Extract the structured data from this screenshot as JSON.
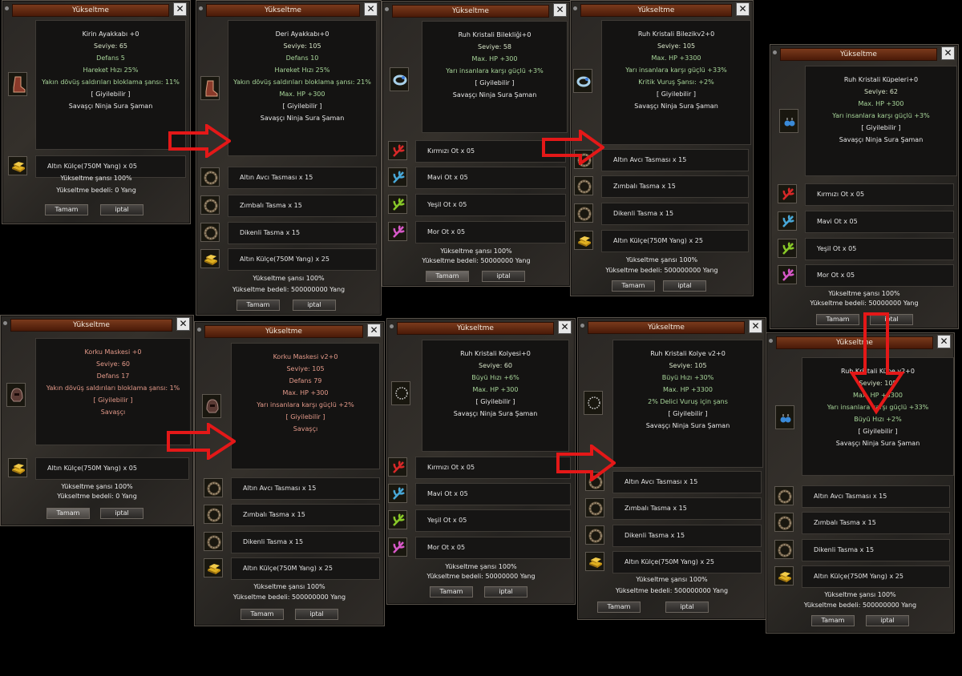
{
  "window_title": "Yükseltme",
  "close_label": "✕",
  "ok_label": "Tamam",
  "cancel_label": "iptal",
  "chance_label": "Yükseltme şansı 100%",
  "cost_0": "Yükseltme bedeli: 0 Yang",
  "cost_500m": "Yükseltme bedeli: 500000000 Yang",
  "cost_50m": "Yükseltme bedeli: 50000000 Yang",
  "wearable": "[ Giyilebilir ]",
  "all_classes": "Savaşçı Ninja Sura Şaman",
  "warrior_only": "Savaşçı",
  "colors": {
    "title_bar": "#6a2e14",
    "stat_green": "#a8d69a",
    "class_red": "#e49a8a",
    "arrow": "#e41818"
  },
  "panels": [
    {
      "name": "kirin-boots",
      "icon": "boots-icon",
      "lines": [
        [
          "Kirin Ayakkabı +0",
          "c-white"
        ],
        [
          "Seviye: 65",
          "c-pale"
        ],
        [
          "Defans 5",
          "c-green"
        ],
        [
          "Hareket Hızı 25%",
          "c-green"
        ],
        [
          "Yakın dövüş saldırıları bloklama şansı: 11%",
          "c-green"
        ],
        [
          "[ Giyilebilir ]",
          "c-white"
        ],
        [
          "Savaşçı Ninja Sura Şaman",
          "c-white"
        ]
      ],
      "materials": [
        {
          "label": "Altın Külçe(750M Yang) x 05",
          "icon": "gold-bar-icon"
        }
      ],
      "cost": "Yükseltme bedeli: 0 Yang"
    },
    {
      "name": "leather-boots",
      "icon": "boots-icon",
      "lines": [
        [
          "Deri Ayakkabı+0",
          "c-white"
        ],
        [
          "Seviye: 105",
          "c-pale"
        ],
        [
          "Defans 10",
          "c-green"
        ],
        [
          "Hareket Hızı 25%",
          "c-green"
        ],
        [
          "Yakın dövüş saldırıları bloklama şansı: 21%",
          "c-green"
        ],
        [
          "Max. HP +300",
          "c-green"
        ],
        [
          "[ Giyilebilir ]",
          "c-white"
        ],
        [
          "Savaşçı Ninja Sura Şaman",
          "c-white"
        ]
      ],
      "materials": [
        {
          "label": "Altın Avcı Tasması x 15",
          "icon": "collar-icon"
        },
        {
          "label": "Zımbalı Tasma x 15",
          "icon": "collar-icon"
        },
        {
          "label": "Dikenli Tasma x 15",
          "icon": "collar-icon"
        },
        {
          "label": "Altın Külçe(750M Yang) x 25",
          "icon": "gold-bar-icon"
        }
      ],
      "cost": "Yükseltme bedeli: 500000000 Yang"
    },
    {
      "name": "soul-crystal-bracelet",
      "icon": "bracelet-icon",
      "lines": [
        [
          "Ruh Kristali Bilekliği+0",
          "c-white"
        ],
        [
          "Seviye: 58",
          "c-pale"
        ],
        [
          "Max. HP +300",
          "c-green"
        ],
        [
          "Yarı insanlara karşı güçlü +3%",
          "c-green"
        ],
        [
          "[ Giyilebilir ]",
          "c-white"
        ],
        [
          "Savaşçı Ninja Sura Şaman",
          "c-white"
        ]
      ],
      "materials": [
        {
          "label": "Kırmızı Ot x 05",
          "icon": "red-herb-icon"
        },
        {
          "label": "Mavi Ot x 05",
          "icon": "blue-herb-icon"
        },
        {
          "label": "Yeşil Ot x 05",
          "icon": "green-herb-icon"
        },
        {
          "label": "Mor Ot x 05",
          "icon": "purple-herb-icon"
        }
      ],
      "cost": "Yükseltme bedeli: 50000000 Yang"
    },
    {
      "name": "soul-crystal-bracelet-v2",
      "icon": "bracelet-icon",
      "lines": [
        [
          "Ruh Kristali Bilezikv2+0",
          "c-white"
        ],
        [
          "Seviye: 105",
          "c-pale"
        ],
        [
          "Max. HP +3300",
          "c-green"
        ],
        [
          "Yarı insanlara karşı güçlü +33%",
          "c-green"
        ],
        [
          "Kritik Vuruş Şansı: +2%",
          "c-green"
        ],
        [
          "[ Giyilebilir ]",
          "c-white"
        ],
        [
          "Savaşçı Ninja Sura Şaman",
          "c-white"
        ]
      ],
      "materials": [
        {
          "label": "Altın Avcı Tasması x 15",
          "icon": "collar-icon"
        },
        {
          "label": "Zımbalı Tasma x 15",
          "icon": "collar-icon"
        },
        {
          "label": "Dikenli Tasma x 15",
          "icon": "collar-icon"
        },
        {
          "label": "Altın Külçe(750M Yang) x 25",
          "icon": "gold-bar-icon"
        }
      ],
      "cost": "Yükseltme bedeli: 500000000 Yang"
    },
    {
      "name": "soul-crystal-earrings",
      "icon": "earring-icon",
      "lines": [
        [
          "Ruh Kristali Küpeleri+0",
          "c-white"
        ],
        [
          "Seviye: 62",
          "c-pale"
        ],
        [
          "Max. HP +300",
          "c-green"
        ],
        [
          "Yarı insanlara karşı güçlü +3%",
          "c-green"
        ],
        [
          "[ Giyilebilir ]",
          "c-white"
        ],
        [
          "Savaşçı Ninja Sura Şaman",
          "c-white"
        ]
      ],
      "materials": [
        {
          "label": "Kırmızı Ot x 05",
          "icon": "red-herb-icon"
        },
        {
          "label": "Mavi Ot x 05",
          "icon": "blue-herb-icon"
        },
        {
          "label": "Yeşil Ot x 05",
          "icon": "green-herb-icon"
        },
        {
          "label": "Mor Ot x 05",
          "icon": "purple-herb-icon"
        }
      ],
      "cost": "Yükseltme bedeli: 50000000 Yang"
    },
    {
      "name": "fear-mask",
      "icon": "helmet-icon",
      "lines": [
        [
          "Korku Maskesi +0",
          "c-red"
        ],
        [
          "Seviye: 60",
          "c-red"
        ],
        [
          "Defans 17",
          "c-red"
        ],
        [
          "Yakın dövüş saldırıları bloklama şansı: 1%",
          "c-red"
        ],
        [
          "[ Giyilebilir ]",
          "c-red"
        ],
        [
          "Savaşçı",
          "c-red"
        ]
      ],
      "materials": [
        {
          "label": "Altın Külçe(750M Yang) x 05",
          "icon": "gold-bar-icon"
        }
      ],
      "cost": "Yükseltme bedeli: 0 Yang"
    },
    {
      "name": "fear-mask-v2",
      "icon": "helmet-icon",
      "lines": [
        [
          "Korku Maskesi v2+0",
          "c-red"
        ],
        [
          "Seviye: 105",
          "c-red"
        ],
        [
          "Defans 79",
          "c-red"
        ],
        [
          "Max. HP +300",
          "c-red"
        ],
        [
          "Yarı insanlara karşı güçlü +2%",
          "c-red"
        ],
        [
          "[ Giyilebilir ]",
          "c-red"
        ],
        [
          "Savaşçı",
          "c-red"
        ]
      ],
      "materials": [
        {
          "label": "Altın Avcı Tasması x 15",
          "icon": "collar-icon"
        },
        {
          "label": "Zımbalı Tasma x 15",
          "icon": "collar-icon"
        },
        {
          "label": "Dikenli Tasma x 15",
          "icon": "collar-icon"
        },
        {
          "label": "Altın Külçe(750M Yang) x 25",
          "icon": "gold-bar-icon"
        }
      ],
      "cost": "Yükseltme bedeli: 500000000 Yang"
    },
    {
      "name": "soul-crystal-necklace",
      "icon": "necklace-icon",
      "lines": [
        [
          "Ruh Kristali Kolyesi+0",
          "c-white"
        ],
        [
          "Seviye: 60",
          "c-pale"
        ],
        [
          "Büyü Hızı +6%",
          "c-green"
        ],
        [
          "Max. HP +300",
          "c-green"
        ],
        [
          "[ Giyilebilir ]",
          "c-white"
        ],
        [
          "Savaşçı Ninja Sura Şaman",
          "c-white"
        ]
      ],
      "materials": [
        {
          "label": "Kırmızı Ot x 05",
          "icon": "red-herb-icon"
        },
        {
          "label": "Mavi Ot x 05",
          "icon": "blue-herb-icon"
        },
        {
          "label": "Yeşil Ot x 05",
          "icon": "green-herb-icon"
        },
        {
          "label": "Mor Ot x 05",
          "icon": "purple-herb-icon"
        }
      ],
      "cost": "Yükseltme bedeli: 50000000 Yang"
    },
    {
      "name": "soul-crystal-necklace-v2",
      "icon": "necklace-icon",
      "lines": [
        [
          "Ruh Kristali Kolye v2+0",
          "c-white"
        ],
        [
          "Seviye: 105",
          "c-pale"
        ],
        [
          "Büyü Hızı +30%",
          "c-green"
        ],
        [
          "Max. HP +3300",
          "c-green"
        ],
        [
          "2% Delici Vuruş için şans",
          "c-green"
        ],
        [
          "[ Giyilebilir ]",
          "c-white"
        ],
        [
          "Savaşçı Ninja Sura Şaman",
          "c-white"
        ]
      ],
      "materials": [
        {
          "label": "Altın Avcı Tasması x 15",
          "icon": "collar-icon"
        },
        {
          "label": "Zımbalı Tasma x 15",
          "icon": "collar-icon"
        },
        {
          "label": "Dikenli Tasma x 15",
          "icon": "collar-icon"
        },
        {
          "label": "Altın Külçe(750M Yang) x 25",
          "icon": "gold-bar-icon"
        }
      ],
      "cost": "Yükseltme bedeli: 500000000 Yang"
    },
    {
      "name": "soul-crystal-earrings-v2",
      "icon": "earring-icon",
      "lines": [
        [
          "Ruh Kristali Küpe v2+0",
          "c-white"
        ],
        [
          "Seviye: 105",
          "c-pale"
        ],
        [
          "Max. HP +3300",
          "c-green"
        ],
        [
          "Yarı insanlara karşı güçlü +33%",
          "c-green"
        ],
        [
          "Büyü Hızı +2%",
          "c-green"
        ],
        [
          "[ Giyilebilir ]",
          "c-white"
        ],
        [
          "Savaşçı Ninja Sura Şaman",
          "c-white"
        ]
      ],
      "materials": [
        {
          "label": "Altın Avcı Tasması x 15",
          "icon": "collar-icon"
        },
        {
          "label": "Zımbalı Tasma x 15",
          "icon": "collar-icon"
        },
        {
          "label": "Dikenli Tasma x 15",
          "icon": "collar-icon"
        },
        {
          "label": "Altın Külçe(750M Yang) x 25",
          "icon": "gold-bar-icon"
        }
      ],
      "cost": "Yükseltme bedeli: 500000000 Yang"
    }
  ]
}
